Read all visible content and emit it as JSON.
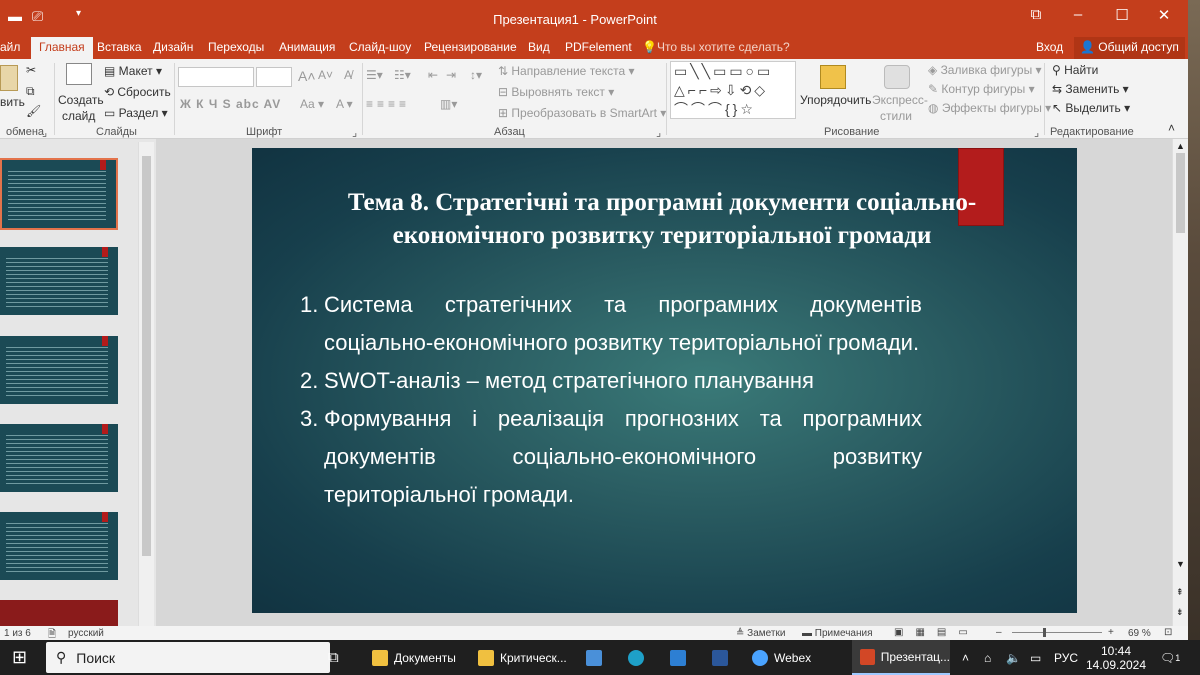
{
  "window": {
    "title": "Презентация1 - PowerPoint",
    "sign_in": "Вход",
    "share": "Общий доступ"
  },
  "tabs": {
    "file": "айл",
    "home": "Главная",
    "insert": "Вставка",
    "design": "Дизайн",
    "transitions": "Переходы",
    "animation": "Анимация",
    "slideshow": "Слайд-шоу",
    "review": "Рецензирование",
    "view": "Вид",
    "pdfelement": "PDFelement",
    "tell_me": "Что вы хотите сделать?"
  },
  "ribbon": {
    "paste": "вить",
    "create_slide_1": "Создать",
    "create_slide_2": "слайд",
    "layout": "Макет",
    "reset": "Сбросить",
    "section": "Раздел",
    "text_direction": "Направление текста",
    "align_text": "Выровнять текст",
    "convert_smartart": "Преобразовать в SmartArt",
    "arrange": "Упорядочить",
    "quick_styles_1": "Экспресс-",
    "quick_styles_2": "стили",
    "shape_fill": "Заливка фигуры",
    "shape_outline": "Контур фигуры",
    "shape_effects": "Эффекты фигуры",
    "find": "Найти",
    "replace": "Заменить",
    "select": "Выделить",
    "font_buttons": "Ж  К  Ч  S  abc  AV",
    "groups": {
      "clipboard": "обмена",
      "slides": "Слайды",
      "font": "Шрифт",
      "paragraph": "Абзац",
      "drawing": "Рисование",
      "editing": "Редактирование"
    }
  },
  "slide": {
    "title": "Тема 8. Стратегічні та програмні документи соціально-економічного розвитку територіальної громади",
    "items": [
      {
        "num": "1.",
        "text": "Система стратегічних та програмних документів соціально-економічного розвитку територіальної громади."
      },
      {
        "num": "2.",
        "text": "SWOT-аналіз – метод стратегічного планування"
      },
      {
        "num": "3.",
        "text": "Формування і реалізація прогнозних та програмних документів соціально-економічного розвитку територіальної громади."
      }
    ]
  },
  "status": {
    "slide_count": "1 из 6",
    "language": "русский",
    "notes": "Заметки",
    "comments": "Примечания",
    "zoom": "69 %"
  },
  "taskbar": {
    "search": "Поиск",
    "apps": [
      {
        "label": "Документы",
        "color": "#f0c040"
      },
      {
        "label": "Критическ...",
        "color": "#f0c040"
      },
      {
        "label": "Webex",
        "color": "#4aa3ff"
      },
      {
        "label": "Презентац...",
        "color": "#d24726"
      }
    ],
    "lang": "РУС",
    "time": "10:44",
    "date": "14.09.2024",
    "notifications": "1"
  }
}
